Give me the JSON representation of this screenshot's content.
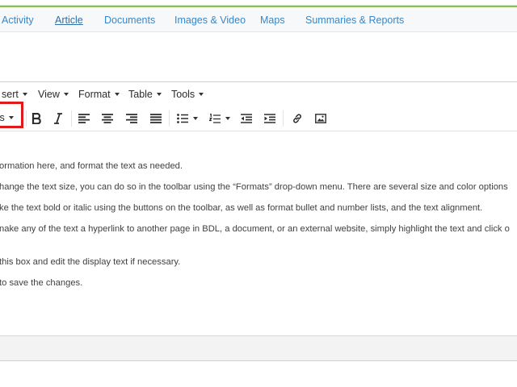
{
  "tabs": [
    {
      "label": "Activity"
    },
    {
      "label": "Article"
    },
    {
      "label": "Documents"
    },
    {
      "label": "Images & Video"
    },
    {
      "label": "Maps"
    },
    {
      "label": "Summaries & Reports"
    }
  ],
  "editor": {
    "menus": [
      {
        "label": "sert"
      },
      {
        "label": "View"
      },
      {
        "label": "Format"
      },
      {
        "label": "Table"
      },
      {
        "label": "Tools"
      }
    ],
    "formats_label": "ts",
    "content_lines": [
      "ormation here, and format the text as needed.",
      "hange the text size, you can do so in the toolbar using the “Formats” drop-down menu. There are several size and color options",
      "ke the text bold or italic using the buttons on the toolbar, as well as format bullet and number lists, and the text alignment.",
      "nake any of the text a hyperlink to another page in BDL, a document, or an external website, simply highlight the text and click o",
      " this box and edit the display text if necessary.",
      " to save the changes."
    ]
  },
  "colors": {
    "accent_green": "#8cc152",
    "tab_link": "#3a86c6",
    "highlight_red": "#e01a1a"
  }
}
